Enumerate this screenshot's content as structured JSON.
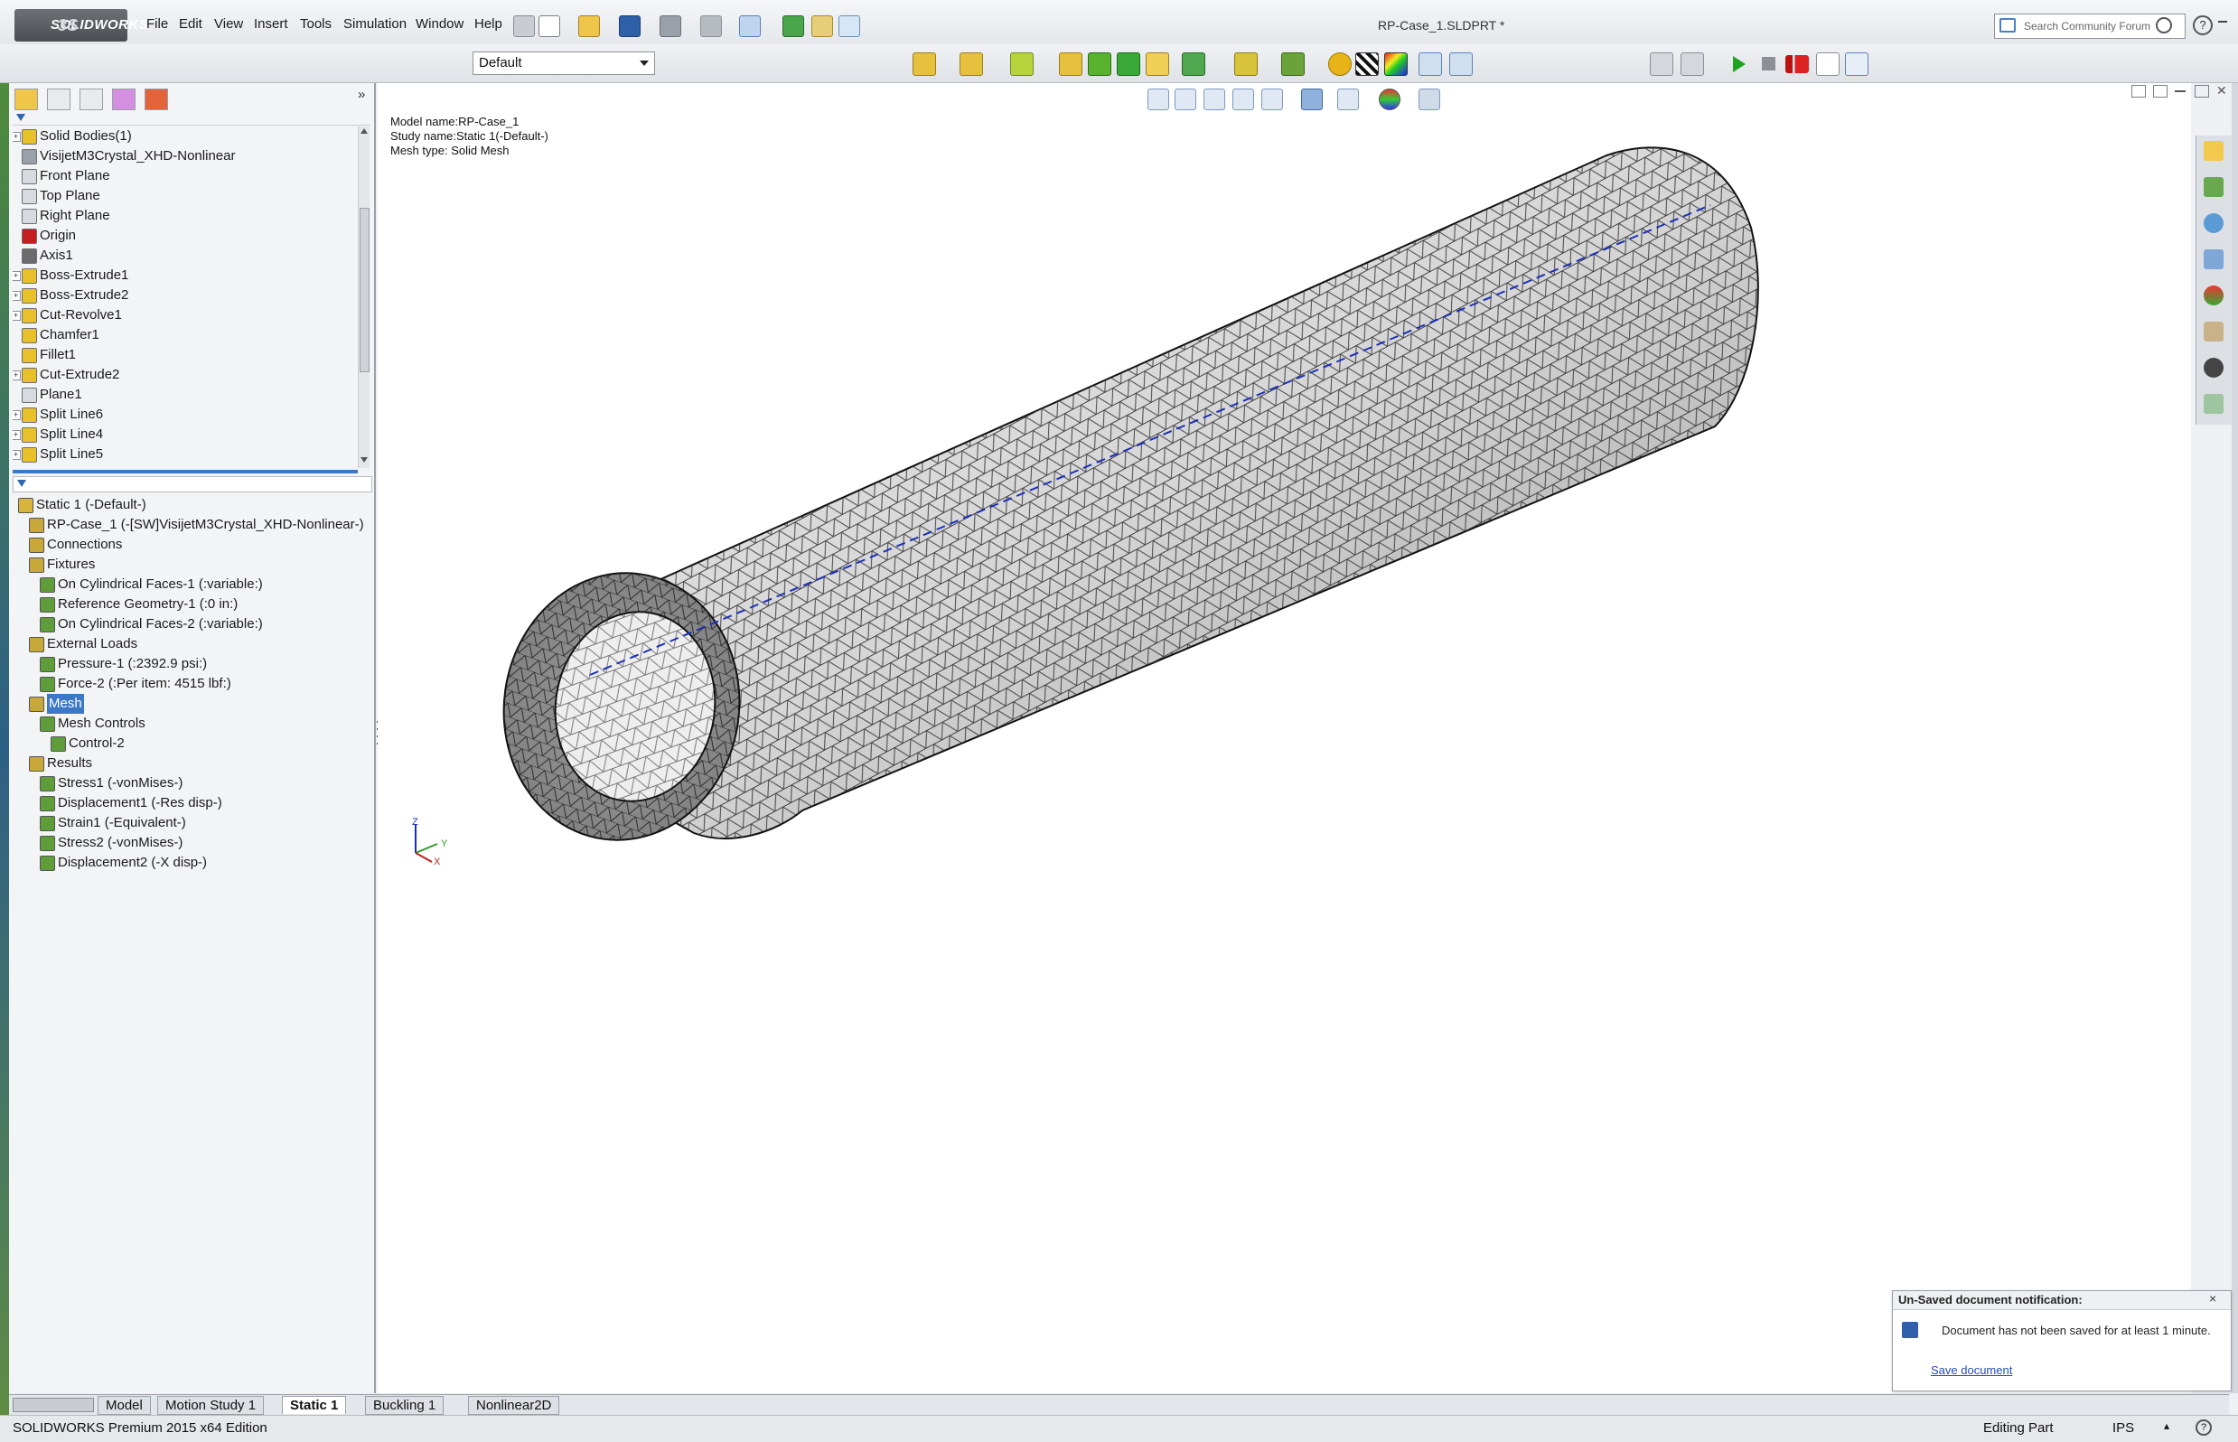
{
  "app": {
    "name": "SOLIDWORKS",
    "document_title": "RP-Case_1.SLDPRT *"
  },
  "menu": [
    "File",
    "Edit",
    "View",
    "Insert",
    "Tools",
    "Simulation",
    "Window",
    "Help"
  ],
  "search": {
    "placeholder": "Search Community Forum"
  },
  "configuration": {
    "selected": "Default"
  },
  "feature_tree": [
    {
      "label": "Solid Bodies(1)",
      "expandable": true,
      "icon": "folder-icon"
    },
    {
      "label": "VisijetM3Crystal_XHD-Nonlinear",
      "expandable": false,
      "icon": "material-icon"
    },
    {
      "label": "Front Plane",
      "expandable": false,
      "icon": "plane-icon"
    },
    {
      "label": "Top Plane",
      "expandable": false,
      "icon": "plane-icon"
    },
    {
      "label": "Right Plane",
      "expandable": false,
      "icon": "plane-icon"
    },
    {
      "label": "Origin",
      "expandable": false,
      "icon": "origin-icon"
    },
    {
      "label": "Axis1",
      "expandable": false,
      "icon": "axis-icon"
    },
    {
      "label": "Boss-Extrude1",
      "expandable": true,
      "icon": "extrude-icon"
    },
    {
      "label": "Boss-Extrude2",
      "expandable": true,
      "icon": "extrude-icon"
    },
    {
      "label": "Cut-Revolve1",
      "expandable": true,
      "icon": "revolve-icon"
    },
    {
      "label": "Chamfer1",
      "expandable": false,
      "icon": "chamfer-icon"
    },
    {
      "label": "Fillet1",
      "expandable": false,
      "icon": "fillet-icon"
    },
    {
      "label": "Cut-Extrude2",
      "expandable": true,
      "icon": "cut-icon"
    },
    {
      "label": "Plane1",
      "expandable": false,
      "icon": "plane-icon"
    },
    {
      "label": "Split Line6",
      "expandable": true,
      "icon": "split-line-icon"
    },
    {
      "label": "Split Line4",
      "expandable": true,
      "icon": "split-line-icon"
    },
    {
      "label": "Split Line5",
      "expandable": true,
      "icon": "split-line-icon"
    }
  ],
  "study_tree": [
    {
      "label": "Static 1 (-Default-)",
      "depth": 0
    },
    {
      "label": "RP-Case_1 (-[SW]VisijetM3Crystal_XHD-Nonlinear-)",
      "depth": 1
    },
    {
      "label": "Connections",
      "depth": 1
    },
    {
      "label": "Fixtures",
      "depth": 1
    },
    {
      "label": "On Cylindrical Faces-1 (:variable:)",
      "depth": 2
    },
    {
      "label": "Reference Geometry-1 (:0 in:)",
      "depth": 2
    },
    {
      "label": "On Cylindrical Faces-2 (:variable:)",
      "depth": 2
    },
    {
      "label": "External Loads",
      "depth": 1
    },
    {
      "label": "Pressure-1 (:2392.9 psi:)",
      "depth": 2
    },
    {
      "label": "Force-2 (:Per item: 4515 lbf:)",
      "depth": 2
    },
    {
      "label": "Mesh",
      "depth": 1,
      "selected": true
    },
    {
      "label": "Mesh Controls",
      "depth": 2
    },
    {
      "label": "Control-2",
      "depth": 3
    },
    {
      "label": "Results",
      "depth": 1
    },
    {
      "label": "Stress1 (-vonMises-)",
      "depth": 2
    },
    {
      "label": "Displacement1 (-Res disp-)",
      "depth": 2
    },
    {
      "label": "Strain1 (-Equivalent-)",
      "depth": 2
    },
    {
      "label": "Stress2 (-vonMises-)",
      "depth": 2
    },
    {
      "label": "Displacement2 (-X disp-)",
      "depth": 2
    }
  ],
  "viewport": {
    "model_name": "Model name:RP-Case_1",
    "study_name": "Study name:Static 1(-Default-)",
    "mesh_type": "Mesh type: Solid Mesh",
    "triad": {
      "x": "X",
      "y": "Y",
      "z": "Z"
    }
  },
  "bottom_tabs": [
    "Model",
    "Motion Study 1",
    "Static 1",
    "Buckling 1",
    "Nonlinear2D"
  ],
  "active_tab": "Static 1",
  "status": {
    "edition": "SOLIDWORKS Premium 2015 x64 Edition",
    "mode": "Editing Part",
    "units": "IPS"
  },
  "notification": {
    "title": "Un-Saved document notification:",
    "message": "Document has not been saved for at least 1 minute.",
    "link": "Save document",
    "close": "×"
  },
  "colors": {
    "selection": "#3d78c7",
    "axis_line": "#1a2fb8",
    "mesh_line": "#2b2b2b",
    "feature_icon": "#e8c12a",
    "status_green": "#2a9d2a"
  }
}
